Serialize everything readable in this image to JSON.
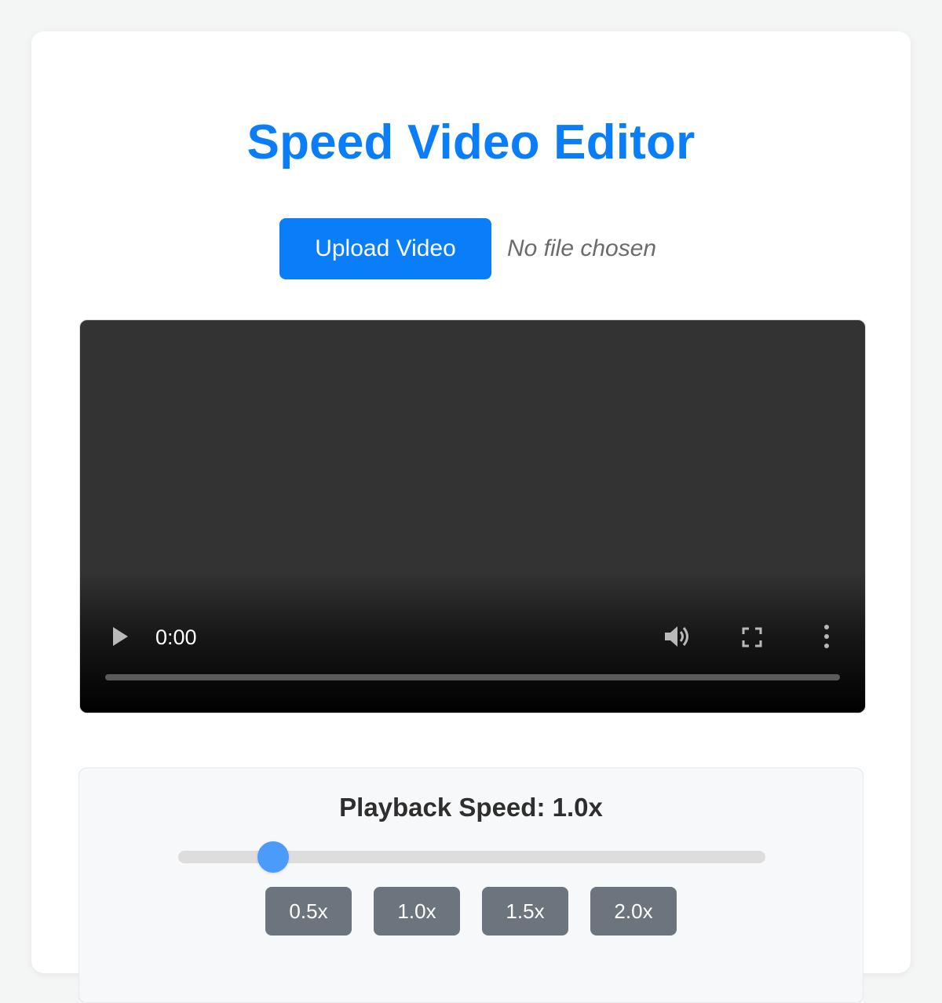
{
  "header": {
    "title": "Speed Video Editor"
  },
  "upload": {
    "button_label": "Upload Video",
    "file_status": "No file chosen"
  },
  "video": {
    "current_time": "0:00",
    "progress_fraction": 0,
    "controls": {
      "play": "play-icon",
      "volume": "volume-icon",
      "fullscreen": "fullscreen-icon",
      "more": "more-options-icon"
    }
  },
  "speed": {
    "label": "Playback Speed: 1.0x",
    "value": 1.0,
    "min": 0.5,
    "max": 4.0,
    "presets": [
      "0.5x",
      "1.0x",
      "1.5x",
      "2.0x"
    ]
  },
  "colors": {
    "accent": "#0a7ef9",
    "slider_thumb": "#4a9bfa",
    "preset_button": "#6c757d",
    "video_background": "#333333"
  }
}
